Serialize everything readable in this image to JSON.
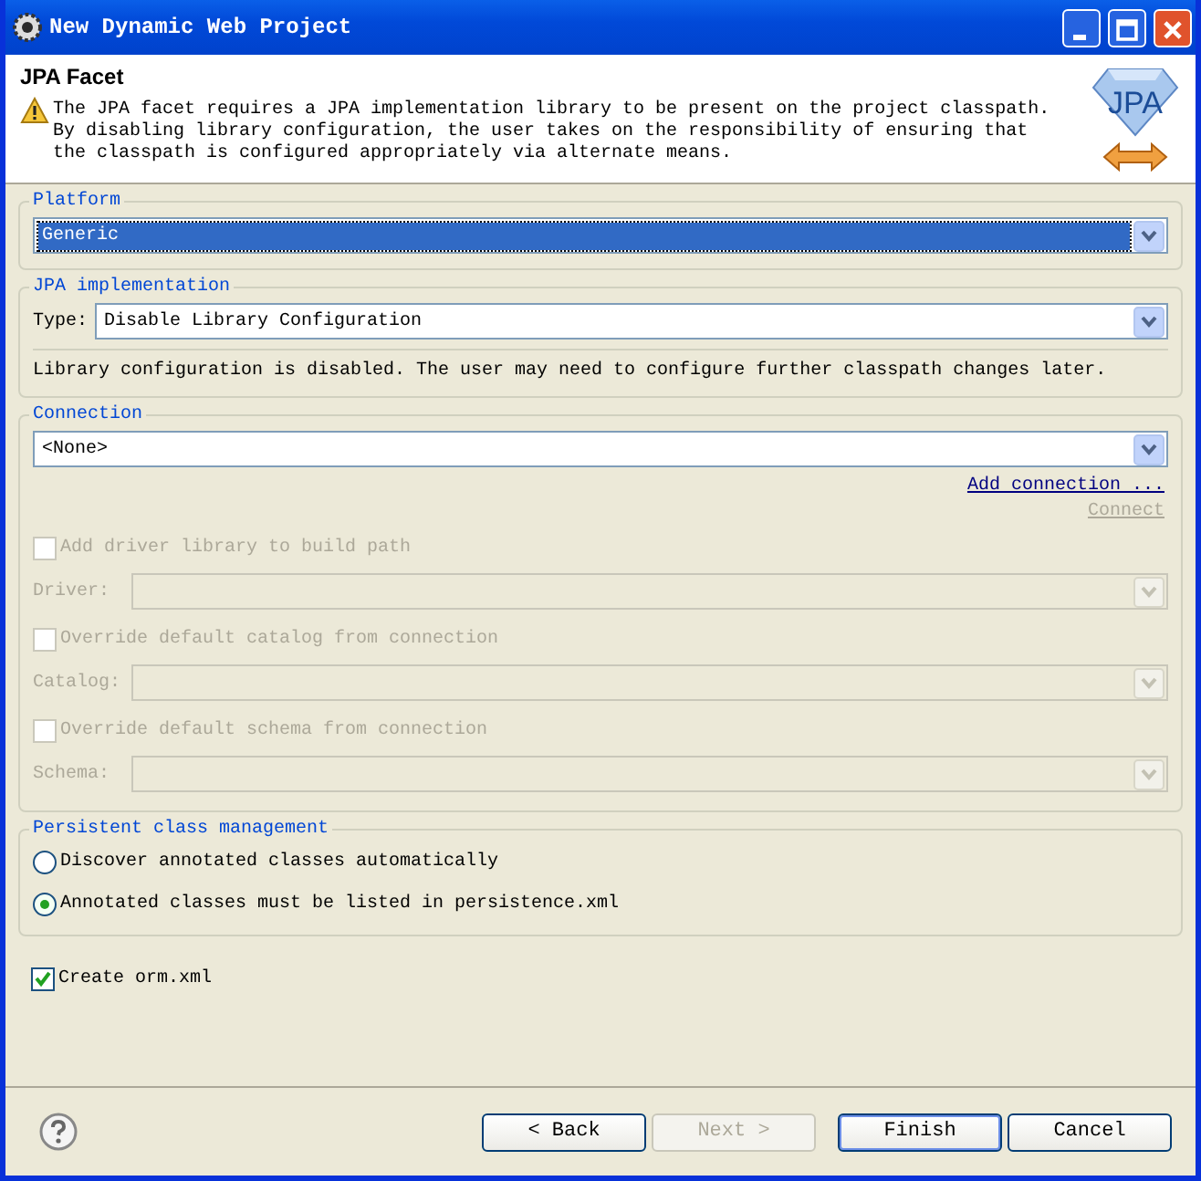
{
  "window": {
    "title": "New Dynamic Web Project"
  },
  "header": {
    "title": "JPA Facet",
    "message": "The JPA facet requires a JPA implementation library to be present on the project classpath.\nBy disabling library configuration, the user takes on the responsibility of ensuring that\nthe classpath is configured appropriately via alternate means.",
    "logo_text": "JPA"
  },
  "platform": {
    "label": "Platform",
    "value": "Generic",
    "selected": true
  },
  "jpa_implementation": {
    "label": "JPA implementation",
    "type_label": "Type:",
    "value": "Disable Library Configuration",
    "note": "Library configuration is disabled. The user may need to configure further classpath changes later."
  },
  "connection": {
    "label": "Connection",
    "value": "<None>",
    "add_link": "Add connection ...",
    "connect_link": "Connect",
    "connect_disabled": true,
    "options": [
      {
        "kind": "checkbox",
        "label": "Add driver library to build path",
        "checked": false,
        "disabled": true
      },
      {
        "kind": "combo",
        "label": "Driver:",
        "disabled": true
      },
      {
        "kind": "checkbox",
        "label": "Override default catalog from connection",
        "checked": false,
        "disabled": true
      },
      {
        "kind": "combo",
        "label": "Catalog:",
        "disabled": true
      },
      {
        "kind": "checkbox",
        "label": "Override default schema from connection",
        "checked": false,
        "disabled": true
      },
      {
        "kind": "combo",
        "label": "Schema:",
        "disabled": true
      }
    ]
  },
  "persistent_class_management": {
    "label": "Persistent class management",
    "options": [
      {
        "label": "Discover annotated classes automatically",
        "selected": false
      },
      {
        "label": "Annotated classes must be listed in persistence.xml",
        "selected": true
      }
    ]
  },
  "create_orm": {
    "label": "Create orm.xml",
    "checked": true
  },
  "buttons": [
    {
      "label": "< Back",
      "disabled": false,
      "default": false
    },
    {
      "label": "Next >",
      "disabled": true,
      "default": false
    },
    {
      "label": "Finish",
      "disabled": false,
      "default": true
    },
    {
      "label": "Cancel",
      "disabled": false,
      "default": false
    }
  ]
}
